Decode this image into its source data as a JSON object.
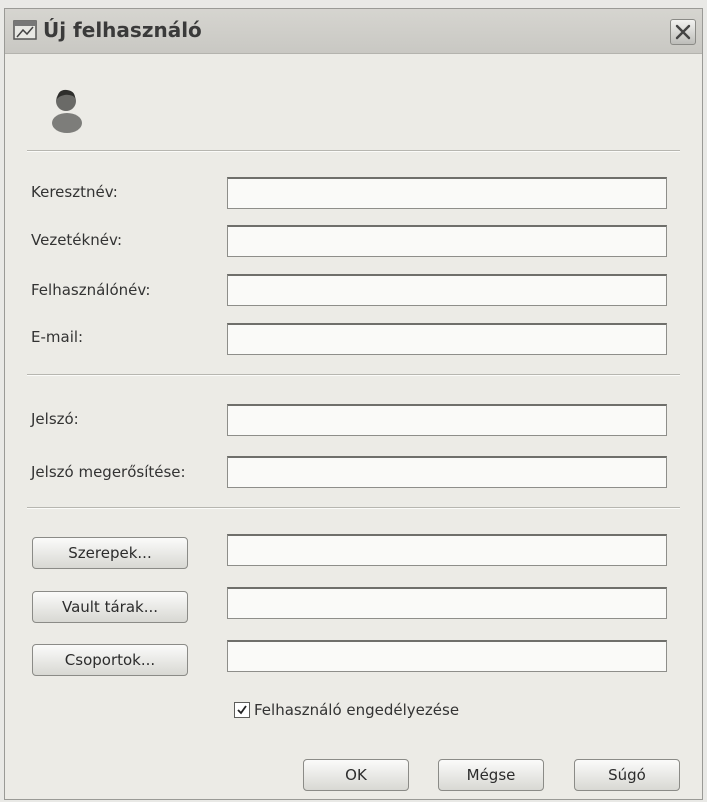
{
  "window": {
    "title": "Új felhasználó",
    "icons": {
      "app": "window-icon",
      "close": "close-icon",
      "user": "user-icon"
    }
  },
  "name_fields": [
    {
      "label": "Keresztnév:",
      "value": ""
    },
    {
      "label": "Vezetéknév:",
      "value": ""
    },
    {
      "label": "Felhasználónév:",
      "value": ""
    },
    {
      "label": "E-mail:",
      "value": ""
    }
  ],
  "password_fields": [
    {
      "label": "Jelszó:",
      "value": ""
    },
    {
      "label": "Jelszó megerősítése:",
      "value": ""
    }
  ],
  "assignments": [
    {
      "button": "Szerepek...",
      "value": ""
    },
    {
      "button": "Vault tárak...",
      "value": ""
    },
    {
      "button": "Csoportok...",
      "value": ""
    }
  ],
  "enable_user": {
    "label": "Felhasználó engedélyezése",
    "checked": true
  },
  "footer": {
    "ok": "OK",
    "cancel": "Mégse",
    "help": "Súgó"
  }
}
